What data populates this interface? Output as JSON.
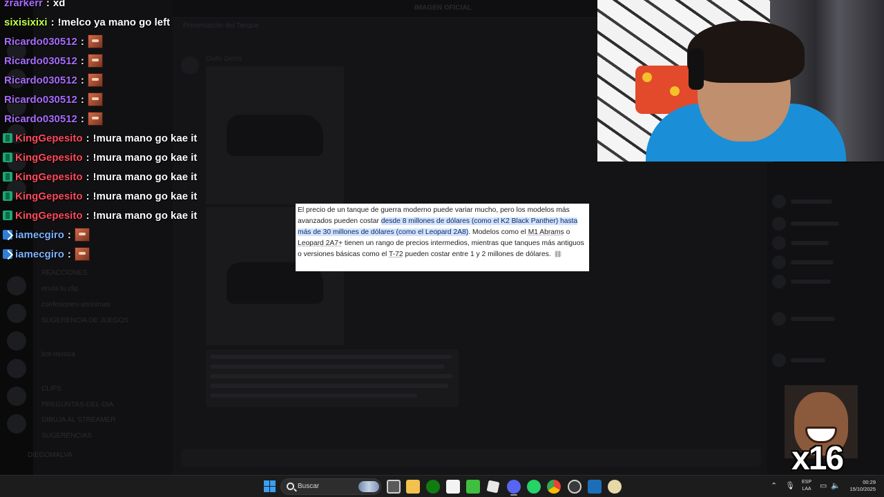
{
  "chat": {
    "top_partial": {
      "user": "zrarkerr",
      "text": "xd"
    },
    "lines": [
      {
        "user": "sixisixixi",
        "user_color": "#c4ff45",
        "badge": "none",
        "text": "!melco ya mano go left",
        "emote": false
      },
      {
        "user": "Ricardo030512",
        "user_color": "#a96cff",
        "badge": "none",
        "text": "",
        "emote": true
      },
      {
        "user": "Ricardo030512",
        "user_color": "#a96cff",
        "badge": "none",
        "text": "",
        "emote": true
      },
      {
        "user": "Ricardo030512",
        "user_color": "#a96cff",
        "badge": "none",
        "text": "",
        "emote": true
      },
      {
        "user": "Ricardo030512",
        "user_color": "#a96cff",
        "badge": "none",
        "text": "",
        "emote": true
      },
      {
        "user": "Ricardo030512",
        "user_color": "#a96cff",
        "badge": "none",
        "text": "",
        "emote": true
      },
      {
        "user": "KingGepesito",
        "user_color": "#ff4a5c",
        "badge": "green",
        "text": "!mura mano go kae it",
        "emote": false
      },
      {
        "user": "KingGepesito",
        "user_color": "#ff4a5c",
        "badge": "green",
        "text": "!mura mano go kae it",
        "emote": false
      },
      {
        "user": "KingGepesito",
        "user_color": "#ff4a5c",
        "badge": "green",
        "text": "!mura mano go kae it",
        "emote": false
      },
      {
        "user": "KingGepesito",
        "user_color": "#ff4a5c",
        "badge": "green",
        "text": "!mura mano go kae it",
        "emote": false
      },
      {
        "user": "KingGepesito",
        "user_color": "#ff4a5c",
        "badge": "green",
        "text": "!mura mano go kae it",
        "emote": false
      },
      {
        "user": "iamecgiro",
        "user_color": "#7db3ff",
        "badge": "blue",
        "text": "",
        "emote": true
      },
      {
        "user": "iamecgiro",
        "user_color": "#7db3ff",
        "badge": "blue",
        "text": "",
        "emote": true
      }
    ],
    "separator": ":"
  },
  "background": {
    "topbar_title": "IMAGEN OFICIAL",
    "thread_title": "Presentación del Tanque",
    "author": "Osito Gerro",
    "channels": [
      "REACCIONES",
      "envía tu clip",
      "confesiones-anónimas",
      "SUGERENCIA DE JUEGOS",
      "bot-música",
      "CLIPS",
      "PREGUNTAS-DEL-DIA",
      "DIBUJA AL STREAMER",
      "SUGERENCIAS"
    ],
    "footer_user": "DIEGOMALVA"
  },
  "popup": {
    "part1": "El precio de un tanque de guerra moderno puede variar mucho, pero los modelos más avanzados pueden costar ",
    "highlight": "desde 8 millones de dólares (como el K2 Black Panther) hasta más de 30 millones de dólares (como el Leopard 2A8)",
    "part2": ". Modelos como el ",
    "m1": "M1 Abrams",
    "or": " o ",
    "leo": "Leopard 2A7+",
    "part3": " tienen un rango de precios intermedios, mientras que tanques más antiguos o versiones básicas como el ",
    "t72": "T-72",
    "part4": " pueden costar entre 1 y 2 millones de dólares.",
    "link_icon": "link-icon"
  },
  "meme": {
    "count": "x16"
  },
  "taskbar": {
    "search_label": "Buscar",
    "lang_line1": "ESP",
    "lang_line2": "LAA",
    "time": "00:29",
    "date": "15/10/2025"
  }
}
